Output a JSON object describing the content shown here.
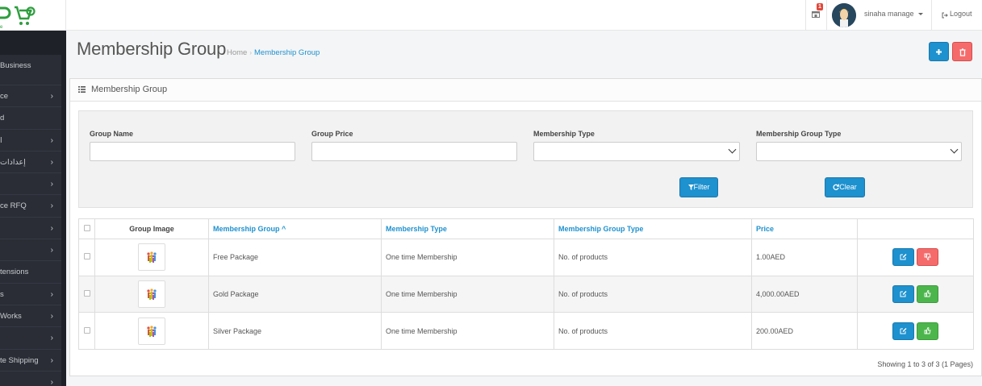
{
  "header": {
    "notification_count": "1",
    "username": "sinaha manage",
    "logout_label": "Logout"
  },
  "sidebar": {
    "items": [
      {
        "label": "Business",
        "has_children": false
      },
      {
        "label": "ce",
        "has_children": true
      },
      {
        "label": "d",
        "has_children": false
      },
      {
        "label": "ا",
        "has_children": true
      },
      {
        "label": "إعدادات",
        "has_children": true
      },
      {
        "label": "",
        "has_children": true
      },
      {
        "label": "ce RFQ",
        "has_children": true
      },
      {
        "label": "",
        "has_children": true
      },
      {
        "label": "",
        "has_children": true
      },
      {
        "label": "tensions",
        "has_children": false
      },
      {
        "label": "s",
        "has_children": true
      },
      {
        "label": "Works",
        "has_children": true
      },
      {
        "label": "",
        "has_children": true
      },
      {
        "label": "te Shipping",
        "has_children": true
      },
      {
        "label": "",
        "has_children": true
      }
    ]
  },
  "page": {
    "title": "Membership Group",
    "breadcrumb": [
      "Home",
      "Membership Group"
    ],
    "add_icon": "plus-icon",
    "delete_icon": "trash-icon"
  },
  "panel": {
    "title": "Membership Group",
    "icon": "list-icon"
  },
  "filter": {
    "group_name_label": "Group Name",
    "group_name_value": "",
    "group_price_label": "Group Price",
    "group_price_value": "",
    "membership_type_label": "Membership Type",
    "membership_type_value": "",
    "membership_group_type_label": "Membership Group Type",
    "membership_group_type_value": "",
    "filter_button": "Filter",
    "clear_button": "Clear"
  },
  "table": {
    "columns": [
      "Group Image",
      "Membership Group",
      "Membership Type",
      "Membership Group Type",
      "Price"
    ],
    "sort_indicator": "^",
    "rows": [
      {
        "group": "Free Package",
        "type": "One time Membership",
        "group_type": "No. of products",
        "price": "1.00AED",
        "status": "disabled"
      },
      {
        "group": "Gold Package",
        "type": "One time Membership",
        "group_type": "No. of products",
        "price": "4,000.00AED",
        "status": "enabled"
      },
      {
        "group": "Silver Package",
        "type": "One time Membership",
        "group_type": "No. of products",
        "price": "200.00AED",
        "status": "enabled"
      }
    ],
    "showing": "Showing 1 to 3 of 3 (1 Pages)"
  },
  "colors": {
    "primary": "#1e91cf",
    "danger": "#f56b6b",
    "success": "#4cb64c",
    "sidebar": "#2a2d35",
    "logo_green": "#2e9e3e"
  }
}
